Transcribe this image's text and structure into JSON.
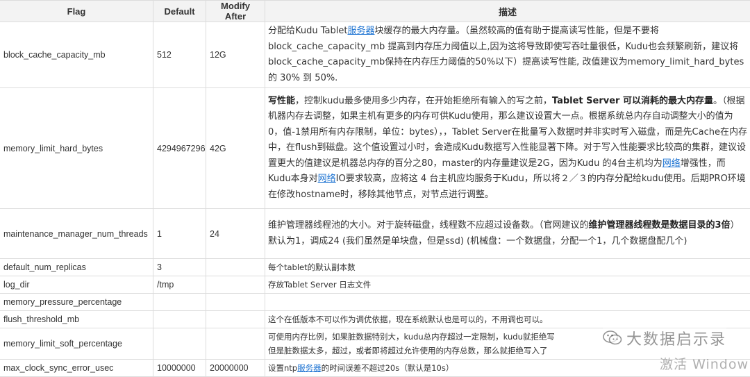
{
  "table": {
    "headers": [
      "Flag",
      "Default",
      "Modify After",
      "描述"
    ],
    "rows": [
      {
        "flag": "block_cache_capacity_mb",
        "default": "512",
        "modify_after": "12G",
        "desc": {
          "p1": "分配给Kudu Tablet",
          "link1": "服务器",
          "p2": "块缓存的最大内存量。（虽然较高的值有助于提高读写性能，但是不要将block_cache_capacity_mb 提高到内存压力阈值以上,因为这将导致即使写吞吐量很低，Kudu也会频繁刷新，建议将block_cache_capacity_mb保持在内存压力阈值的50%以下）提高读写性能, 改值建议为memory_limit_hard_bytes 的 30% 到 50%."
        }
      },
      {
        "flag": "memory_limit_hard_bytes",
        "default": "4294967296",
        "modify_after": "42G",
        "desc": {
          "b1": "写性能",
          "p1": "，控制kudu最多使用多少内存，在开始拒绝所有输入的写之前，",
          "b2": "Tablet Server 可以消耗的最大内存量",
          "p2": "。（根据机器内存去调整，如果主机有更多的内存可供Kudu使用，那么建议设置大一点。根据系统总内存自动调整大小的值为0，值-1禁用所有内存限制，单位：bytes），，Tablet Server在批量写入数据时并非实时写入磁盘，而是先Cache在内存中，在flush到磁盘。这个值设置过小时，会造成Kudu数据写入性能显著下降。对于写入性能要求比较高的集群，建议设置更大的值建议是机器总内存的百分之80，master的内存量建议是2G，因为Kudu 的4台主机均为",
          "link1": "网络",
          "p3": "增强性，而Kudu本身对",
          "link2": "网络",
          "p4": "IO要求较高，应将这 4 台主机应均服务于Kudu，所以将２／３的内存分配给kudu使用。后期PRO环境在修改hostname时，移除其他节点，对节点进行调整。"
        }
      },
      {
        "flag": "maintenance_manager_num_threads",
        "default": "1",
        "modify_after": "24",
        "desc": {
          "p1": "维护管理器线程池的大小。对于旋转磁盘，线程数不应超过设备数。（官网建议的",
          "b1": "维护管理器线程数是数据目录的3倍",
          "p2": "）默认为1，调成24 (我们虽然是单块盘，但是ssd) (机械盘：一个数据盘，分配一个1，几个数据盘配几个)"
        }
      },
      {
        "flag": "default_num_replicas",
        "default": "3",
        "modify_after": "",
        "desc": {
          "p1": "每个tablet的默认副本数"
        }
      },
      {
        "flag": "log_dir",
        "default": "/tmp",
        "modify_after": "",
        "desc": {
          "p1": "存放Tablet Server 日志文件"
        }
      },
      {
        "flag": "memory_pressure_percentage",
        "default": "",
        "modify_after": "",
        "desc": {
          "p1": ""
        }
      },
      {
        "flag": "flush_threshold_mb",
        "default": "",
        "modify_after": "",
        "desc": {
          "p1": "这个在低版本不可以作为调优依据，现在系统默认也是可以的，不用调也可以。"
        }
      },
      {
        "flag": "memory_limit_soft_percentage",
        "default": "",
        "modify_after": "",
        "desc": {
          "p1": "可使用内存比例，如果脏数据特别大，kudu总内存超过一定限制，kudu就拒绝写",
          "p2": "但是脏数据太多，超过，或者即将超过允许使用的内存总数，那么就拒绝写入了"
        }
      },
      {
        "flag": "max_clock_sync_error_usec",
        "default": "10000000",
        "modify_after": "20000000",
        "desc": {
          "p1": "设置ntp",
          "link1": "服务器",
          "p2": "的时间误差不超过20s（默认是10s）"
        }
      }
    ]
  },
  "watermark": {
    "text": "大数据启示录",
    "icon": "wechat-icon"
  },
  "os_overlay": {
    "text": "激活 Window"
  },
  "colors": {
    "link": "#1d73d2",
    "header_bg": "#f3f3f3",
    "border": "#dcdcdc"
  }
}
